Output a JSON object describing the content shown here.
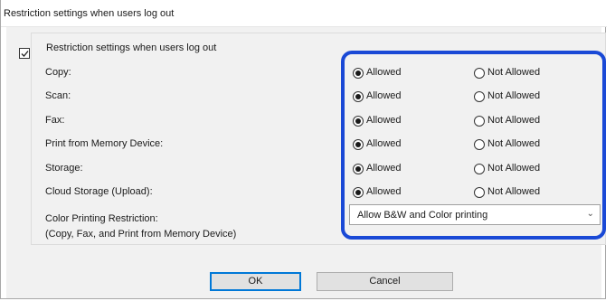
{
  "window": {
    "title": "Restriction settings when users log out"
  },
  "group": {
    "title": "Restriction settings when users log out",
    "checked": true
  },
  "rows": [
    {
      "label": "Copy:",
      "allowed": "Allowed",
      "not_allowed": "Not Allowed",
      "selected": "allowed"
    },
    {
      "label": "Scan:",
      "allowed": "Allowed",
      "not_allowed": "Not Allowed",
      "selected": "allowed"
    },
    {
      "label": "Fax:",
      "allowed": "Allowed",
      "not_allowed": "Not Allowed",
      "selected": "allowed"
    },
    {
      "label": "Print from Memory Device:",
      "allowed": "Allowed",
      "not_allowed": "Not Allowed",
      "selected": "allowed"
    },
    {
      "label": "Storage:",
      "allowed": "Allowed",
      "not_allowed": "Not Allowed",
      "selected": "allowed"
    },
    {
      "label": "Cloud Storage (Upload):",
      "allowed": "Allowed",
      "not_allowed": "Not Allowed",
      "selected": "allowed"
    }
  ],
  "color_restriction": {
    "label_line1": "Color Printing Restriction:",
    "label_line2": "(Copy, Fax, and Print from Memory Device)",
    "selected": "Allow B&W and Color printing"
  },
  "buttons": {
    "ok": "OK",
    "cancel": "Cancel"
  },
  "colors": {
    "highlight": "#1a49d6",
    "background": "#f1f1f1"
  }
}
